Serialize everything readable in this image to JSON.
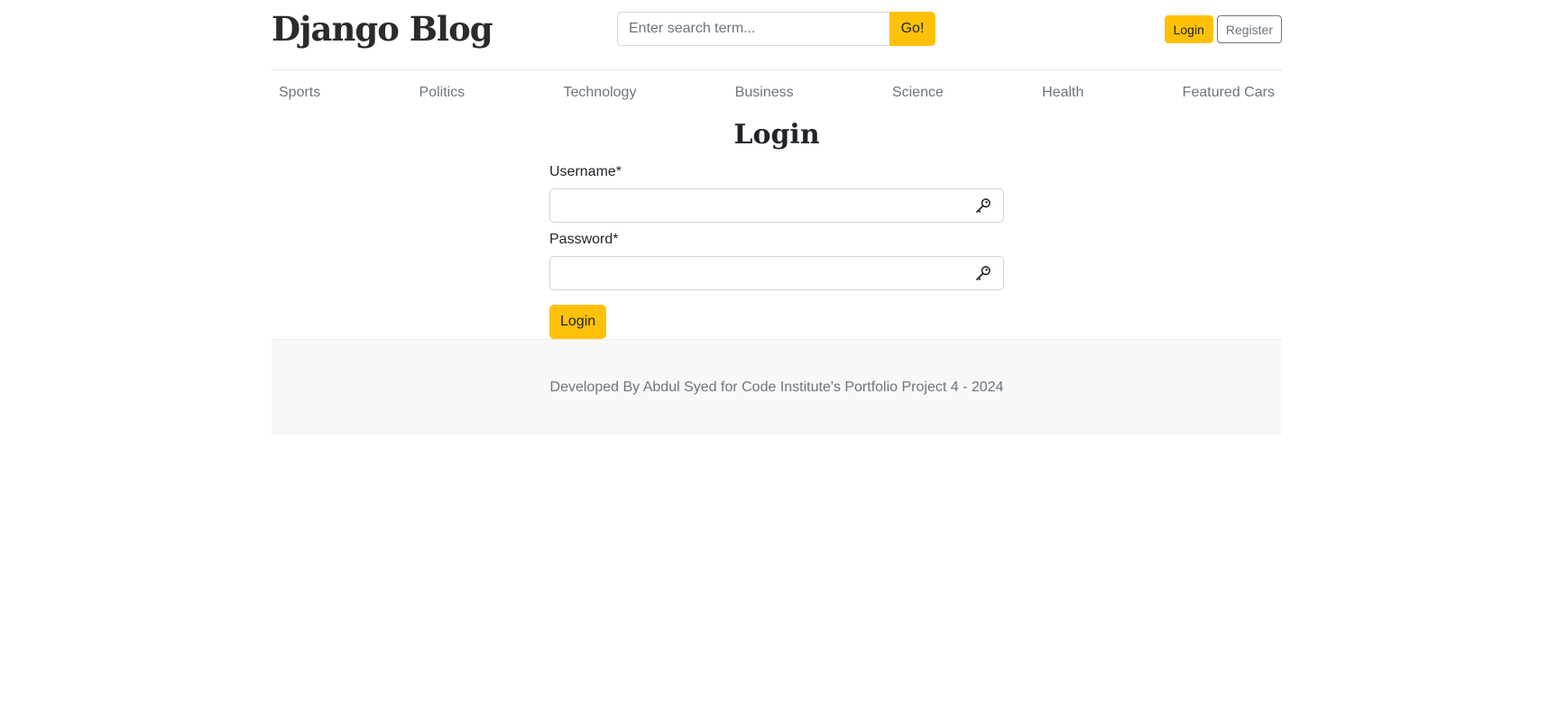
{
  "header": {
    "brand": "Django Blog",
    "search_placeholder": "Enter search term...",
    "search_button": "Go!",
    "login_label": "Login",
    "register_label": "Register"
  },
  "nav": {
    "items": [
      "Sports",
      "Politics",
      "Technology",
      "Business",
      "Science",
      "Health",
      "Featured Cars"
    ]
  },
  "login_form": {
    "title": "Login",
    "username_label": "Username*",
    "username_value": "",
    "password_label": "Password*",
    "password_value": "",
    "field_icon": "key-icon",
    "submit_label": "Login"
  },
  "footer": {
    "text": "Developed By Abdul Syed for Code Institute's Portfolio Project 4 - 2024"
  },
  "colors": {
    "accent": "#ffc107",
    "muted_text": "#6c757d",
    "footer_bg": "#f8f8f8"
  }
}
